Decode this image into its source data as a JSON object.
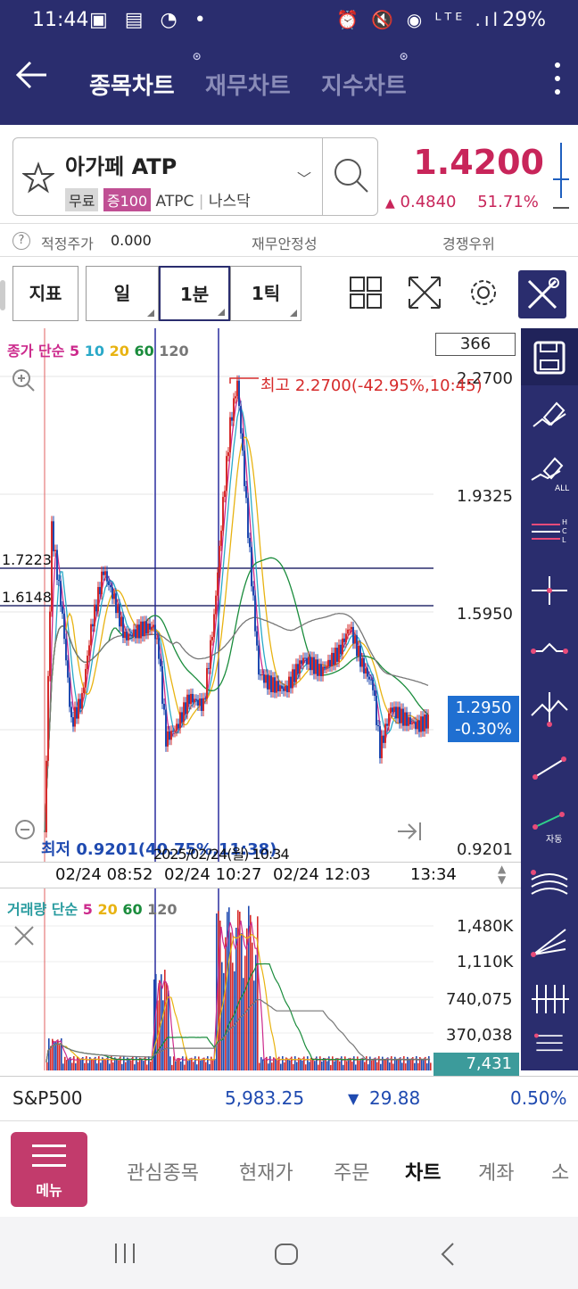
{
  "status": {
    "time": "11:44",
    "left_icons": "▣ ▤ ◔ •",
    "right_icons": "⏰ 🔇 ◉ ᴸᵀᴱ .ıl",
    "battery": "29%"
  },
  "header": {
    "tabs": [
      {
        "label": "종목차트",
        "active": true
      },
      {
        "label": "재무차트",
        "active": false
      },
      {
        "label": "지수차트",
        "active": false
      }
    ]
  },
  "stock": {
    "name": "아가페 ATP",
    "tags": [
      "무료",
      "증100"
    ],
    "ticker": "ATPC",
    "market": "나스닥",
    "price": "1.4200",
    "change_arrow": "▲",
    "change": "0.4840",
    "change_pct": "51.71%"
  },
  "info": {
    "fair_label": "적정주가",
    "fair_value": "0.000",
    "finance_label": "재무안정성",
    "rank_label": "경쟁우위"
  },
  "toolbar": {
    "indicator": "지표",
    "period_day": "일",
    "period_min": "1분",
    "period_tick": "1틱"
  },
  "chart": {
    "legend_prefix": "종가 단순",
    "ma": [
      "5",
      "10",
      "20",
      "60",
      "120"
    ],
    "ma_colors": [
      "#cc2a8c",
      "#2aa9c8",
      "#e8b312",
      "#1a8c3c",
      "#777777"
    ],
    "count_box": "366",
    "y_labels": [
      "2.2700",
      "1.9325",
      "1.5950",
      "0.9201"
    ],
    "current_price": "1.2950",
    "current_pct": "-0.30%",
    "hline1": "1.7223",
    "hline2": "1.6148",
    "high_label": "최고 2.2700(-42.95%,10:45)",
    "low_label": "최저 0.9201(40.75%,11:38)",
    "cross_date": "2025/02/24(월) 10:34",
    "x_labels": [
      "02/24 08:52",
      "02/24 10:27",
      "02/24 12:03",
      "13:34"
    ]
  },
  "volume": {
    "legend_prefix": "거래량 단순",
    "ma": [
      "5",
      "20",
      "60",
      "120"
    ],
    "y_labels": [
      "1,480K",
      "1,110K",
      "740,075",
      "370,038"
    ],
    "current": "7,431"
  },
  "ticker_bar": {
    "name": "S&P500",
    "value": "5,983.25",
    "arrow": "▼",
    "change": "29.88",
    "pct": "0.50%"
  },
  "bottom_nav": {
    "menu": "메뉴",
    "items": [
      {
        "label": "관심종목",
        "active": false
      },
      {
        "label": "현재가",
        "active": false
      },
      {
        "label": "주문",
        "active": false
      },
      {
        "label": "차트",
        "active": true
      },
      {
        "label": "계좌",
        "active": false
      },
      {
        "label": "소",
        "active": false
      }
    ]
  }
}
